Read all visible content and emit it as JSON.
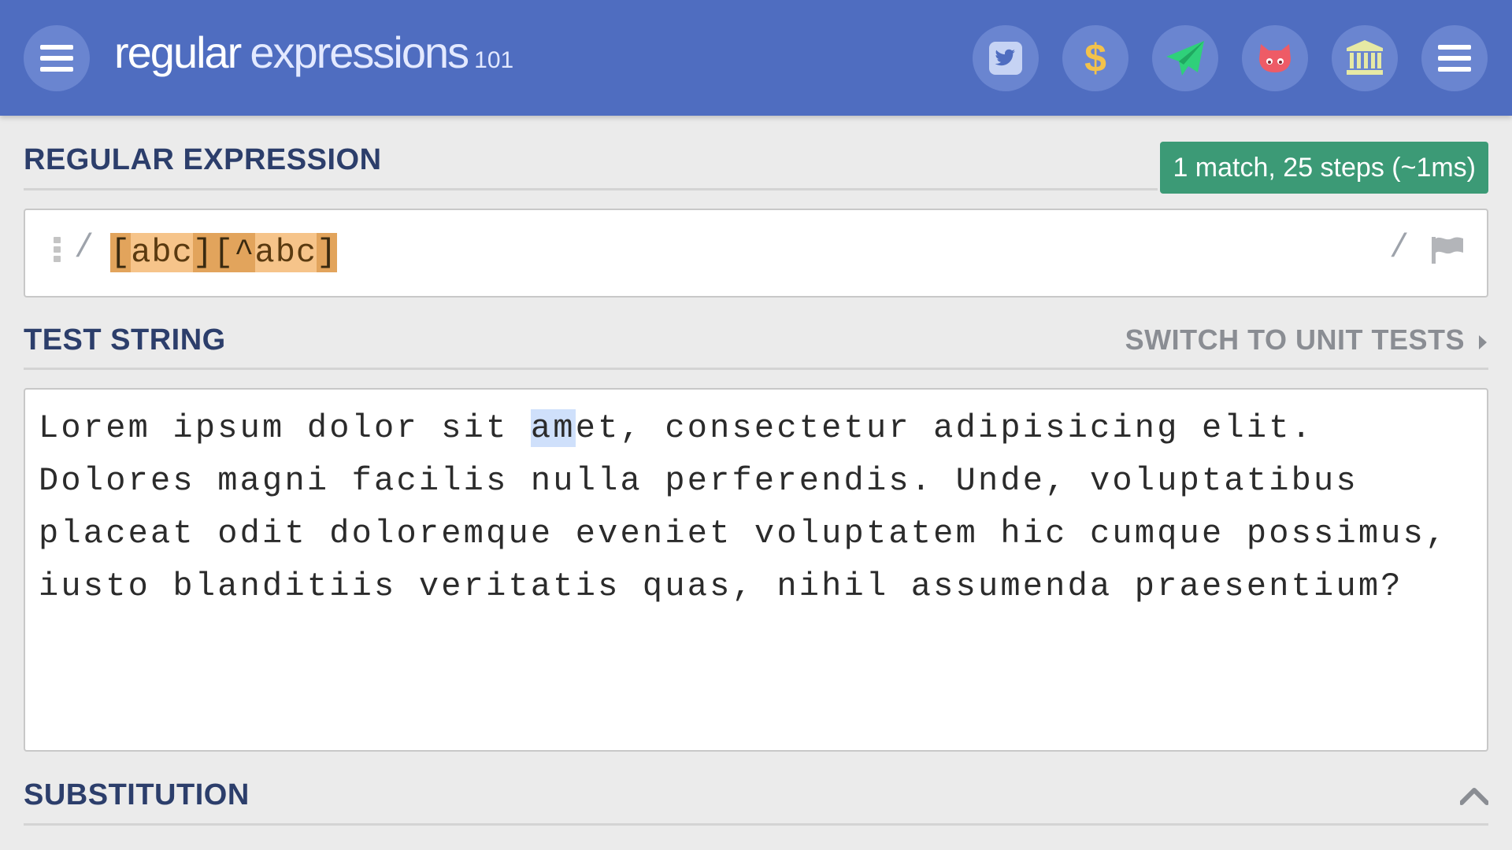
{
  "header": {
    "logo_word1": "regular",
    "logo_word2": "expressions",
    "logo_version": "101",
    "icons": [
      "menu-icon",
      "twitter-icon",
      "dollar-icon",
      "send-icon",
      "github-icon",
      "library-icon",
      "menu-icon"
    ],
    "colors": {
      "bar": "#4f6dc0",
      "button": "#6a85d0",
      "twitter": "#4f6dc0",
      "dollar": "#f3c24a",
      "send": "#2fd07a",
      "github": "#ee5b66",
      "library": "#e6e9a4"
    }
  },
  "regex": {
    "section_title": "REGULAR EXPRESSION",
    "match_info": "1 match, 25 steps (~1ms)",
    "open_delimiter": "/",
    "close_delimiter": "/",
    "tokens": [
      "[",
      "abc",
      "]",
      "[",
      "^",
      "abc",
      "]"
    ]
  },
  "test": {
    "section_title": "TEST STRING",
    "switch_label": "SWITCH TO UNIT TESTS",
    "text_before": "Lorem ipsum dolor sit ",
    "text_match": "am",
    "text_after": "et, consectetur adipisicing elit. Dolores magni facilis nulla perferendis. Unde, voluptatibus placeat odit doloremque eveniet voluptatem hic cumque possimus, iusto blanditiis veritatis quas, nihil assumenda praesentium?"
  },
  "substitution": {
    "section_title": "SUBSTITUTION"
  }
}
